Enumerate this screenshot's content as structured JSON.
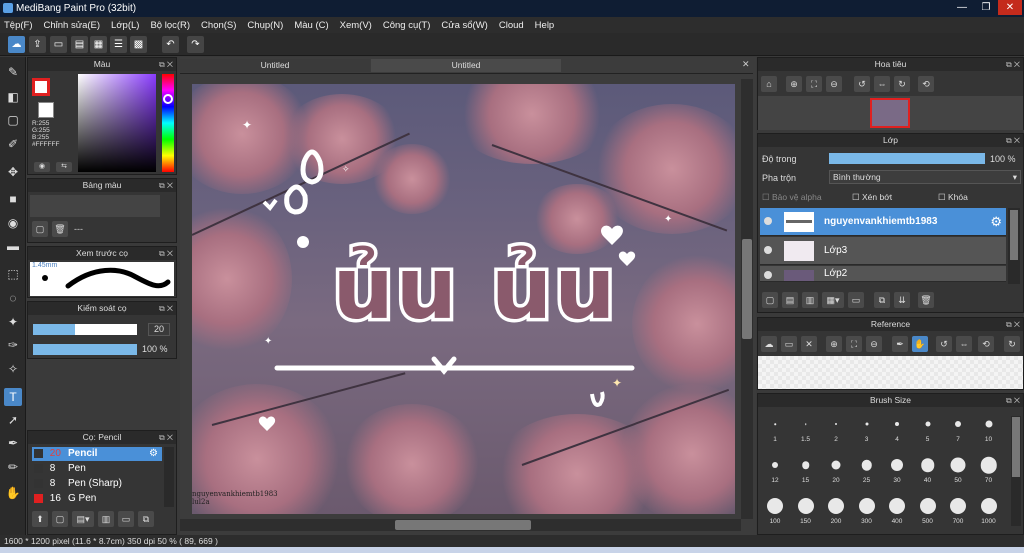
{
  "window": {
    "title": "MediBang Paint Pro (32bit)"
  },
  "menu": [
    "Tệp(F)",
    "Chỉnh sửa(E)",
    "Lớp(L)",
    "Bộ lọc(R)",
    "Chọn(S)",
    "Chụp(N)",
    "Màu (C)",
    "Xem(V)",
    "Công cụ(T)",
    "Cửa sổ(W)",
    "Cloud",
    "Help"
  ],
  "color_panel": {
    "title": "Màu",
    "r": "R:255",
    "g": "G:255",
    "b": "B:255",
    "hex": "#FFFFFF",
    "primary": "#e02020",
    "secondary": "#ffffff"
  },
  "palette_panel": {
    "title": "Bảng màu",
    "value": "---"
  },
  "brush_preview": {
    "title": "Xem trước cọ",
    "size": "1.45mm"
  },
  "brush_control": {
    "title": "Kiểm soát cọ",
    "size": "20",
    "opacity": "100 %",
    "size_fraction": 0.4,
    "opacity_fraction": 1.0
  },
  "brush_list": {
    "title": "Cọ: Pencil",
    "items": [
      {
        "size": "20",
        "name": "Pencil",
        "color": "#333333"
      },
      {
        "size": "8",
        "name": "Pen",
        "color": "#333333"
      },
      {
        "size": "8",
        "name": "Pen (Sharp)",
        "color": "#333333"
      },
      {
        "size": "16",
        "name": "G Pen",
        "color": "#e02020"
      }
    ]
  },
  "tabs": [
    "Untitled",
    "Untitled"
  ],
  "artwork": {
    "text": "ủu ủu",
    "watermark": "nguyenvankhiemtb1983",
    "watermark2": "lul2a"
  },
  "navigator": {
    "title": "Hoa tiêu"
  },
  "layer_panel": {
    "title": "Lớp",
    "opacity_label": "Độ trong",
    "opacity_value": "100 %",
    "opacity_fraction": 1.0,
    "blend_label": "Pha trộn",
    "blend_value": "Bình thường",
    "protect_alpha": "Bảo vệ alpha",
    "clipping": "Xén bớt",
    "lock": "Khóa",
    "layers": [
      {
        "name": "nguyenvankhiemtb1983"
      },
      {
        "name": "Lớp3"
      },
      {
        "name": "Lớp2"
      }
    ]
  },
  "reference": {
    "title": "Reference"
  },
  "brush_size": {
    "title": "Brush Size",
    "sizes": [
      "1",
      "1.5",
      "2",
      "3",
      "4",
      "5",
      "7",
      "10",
      "12",
      "15",
      "20",
      "25",
      "30",
      "40",
      "50",
      "70",
      "100",
      "150",
      "200",
      "300",
      "400",
      "500",
      "700",
      "1000"
    ]
  },
  "status": {
    "text": "1600 * 1200 pixel   (11.6 * 8.7cm)   350 dpi   50 %   ( 89, 669 )"
  }
}
